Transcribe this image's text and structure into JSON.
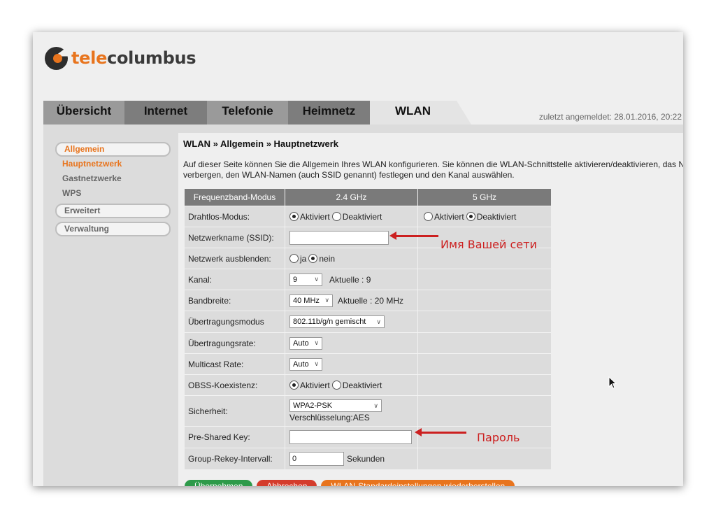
{
  "brand": {
    "prefix": "tele",
    "suffix": "columbus"
  },
  "tabs": [
    "Übersicht",
    "Internet",
    "Telefonie",
    "Heimnetz",
    "WLAN"
  ],
  "last_login": "zuletzt angemeldet: 28.01.2016, 20:22",
  "sidebar": {
    "allgemein": "Allgemein",
    "items": [
      "Hauptnetzwerk",
      "Gastnetzwerke",
      "WPS"
    ],
    "erweitert": "Erweitert",
    "verwaltung": "Verwaltung"
  },
  "breadcrumb": "WLAN » Allgemein » Hauptnetzwerk",
  "description": {
    "line1": "Auf dieser Seite können Sie die Allgemein Ihres WLAN konfigurieren. Sie können die WLAN-Schnittstelle aktivieren/deaktivieren, das Netz",
    "line2": "verbergen, den WLAN-Namen (auch SSID genannt) festlegen und den Kanal auswählen."
  },
  "table": {
    "headers": [
      "Frequenzband-Modus",
      "2.4 GHz",
      "5 GHz"
    ],
    "labels": {
      "drahtlos": "Drahtlos-Modus:",
      "ssid": "Netzwerkname (SSID):",
      "hide": "Netzwerk ausblenden:",
      "kanal": "Kanal:",
      "bandbreite": "Bandbreite:",
      "modus": "Übertragungsmodus",
      "rate": "Übertragungsrate:",
      "multicast": "Multicast Rate:",
      "obss": "OBSS-Koexistenz:",
      "sicherheit": "Sicherheit:",
      "psk": "Pre-Shared Key:",
      "rekey": "Group-Rekey-Intervall:"
    },
    "opt_on": "Aktiviert",
    "opt_off": "Deaktiviert",
    "opt_ja": "ja",
    "opt_nein": "nein",
    "kanal_value": "9",
    "kanal_current": "Aktuelle :  9",
    "bandbreite_value": "40 MHz",
    "bandbreite_current": "Aktuelle :  20 MHz",
    "modus_value": "802.11b/g/n gemischt",
    "rate_value": "Auto",
    "multicast_value": "Auto",
    "sicherheit_value": "WPA2-PSK",
    "encryption": "Verschlüsselung:AES",
    "rekey_value": "0",
    "rekey_unit": "Sekunden"
  },
  "annotations": {
    "ssid": "Имя Вашей сети",
    "password": "Пароль"
  },
  "buttons": {
    "apply": "Übernehmen",
    "cancel": "Abbrechen",
    "defaults": "WLAN-Standardeinstellungen wiederherstellen"
  },
  "colors": {
    "accent": "#e8741d",
    "annotation": "#cc2020"
  }
}
